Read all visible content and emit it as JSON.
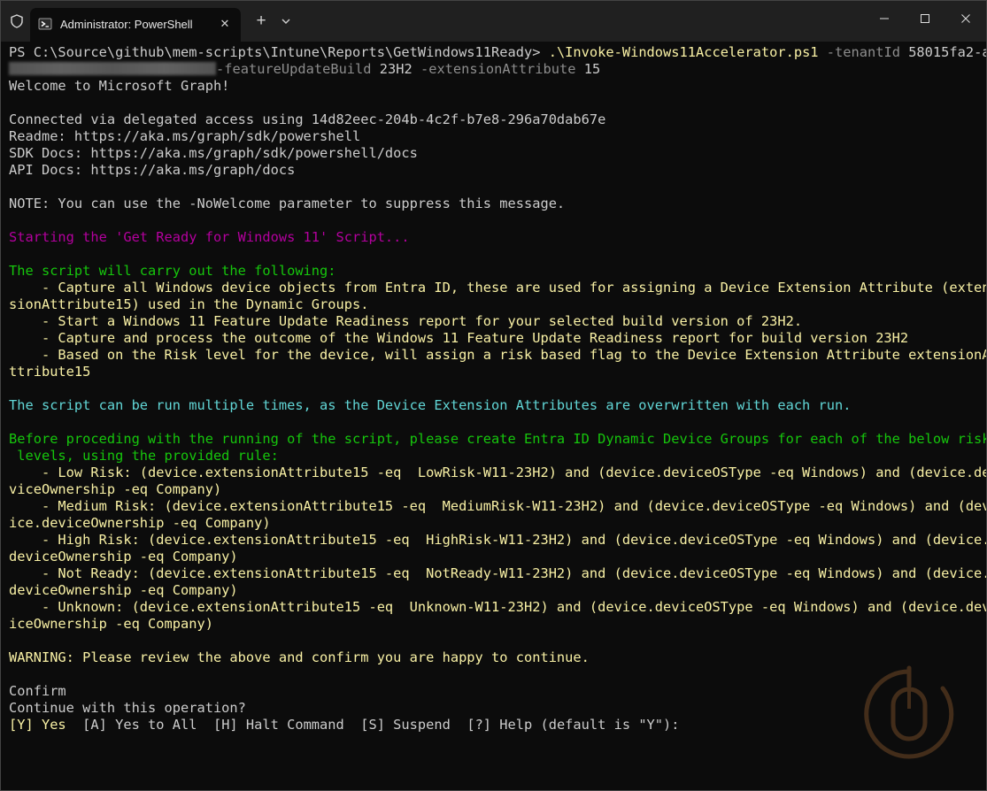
{
  "window": {
    "tab_title": "Administrator: PowerShell",
    "tab_close": "✕",
    "new_tab": "+"
  },
  "terminal": {
    "lines": [
      {
        "segments": [
          {
            "text": "PS C:\\Source\\github\\mem-scripts\\Intune\\Reports\\GetWindows11Ready> ",
            "color": "def"
          },
          {
            "text": ".\\Invoke-Windows11Accelerator.ps1",
            "color": "yel"
          },
          {
            "text": " -tenantId ",
            "color": "gry"
          },
          {
            "text": "58015fa2-a",
            "color": "def"
          }
        ]
      },
      {
        "segments": [
          {
            "text": "",
            "color": "def",
            "redacted": true
          },
          {
            "text": "-featureUpdateBuild ",
            "color": "gry"
          },
          {
            "text": "23H2 ",
            "color": "def"
          },
          {
            "text": "-extensionAttribute ",
            "color": "gry"
          },
          {
            "text": "15",
            "color": "def"
          }
        ]
      },
      {
        "segments": [
          {
            "text": "Welcome to Microsoft Graph!",
            "color": "def"
          }
        ]
      },
      {
        "segments": [
          {
            "text": "",
            "color": "def"
          }
        ]
      },
      {
        "segments": [
          {
            "text": "Connected via delegated access using 14d82eec-204b-4c2f-b7e8-296a70dab67e",
            "color": "def"
          }
        ]
      },
      {
        "segments": [
          {
            "text": "Readme: https://aka.ms/graph/sdk/powershell",
            "color": "def"
          }
        ]
      },
      {
        "segments": [
          {
            "text": "SDK Docs: https://aka.ms/graph/sdk/powershell/docs",
            "color": "def"
          }
        ]
      },
      {
        "segments": [
          {
            "text": "API Docs: https://aka.ms/graph/docs",
            "color": "def"
          }
        ]
      },
      {
        "segments": [
          {
            "text": "",
            "color": "def"
          }
        ]
      },
      {
        "segments": [
          {
            "text": "NOTE: You can use the -NoWelcome parameter to suppress this message.",
            "color": "def"
          }
        ]
      },
      {
        "segments": [
          {
            "text": "",
            "color": "def"
          }
        ]
      },
      {
        "segments": [
          {
            "text": "Starting the 'Get Ready for Windows 11' Script...",
            "color": "mag"
          }
        ]
      },
      {
        "segments": [
          {
            "text": "",
            "color": "def"
          }
        ]
      },
      {
        "segments": [
          {
            "text": "The script will carry out the following:",
            "color": "grn"
          }
        ]
      },
      {
        "segments": [
          {
            "text": "    - Capture all Windows device objects from Entra ID, these are used for assigning a Device Extension Attribute (exten",
            "color": "yel"
          }
        ]
      },
      {
        "segments": [
          {
            "text": "sionAttribute15) used in the Dynamic Groups.",
            "color": "yel"
          }
        ]
      },
      {
        "segments": [
          {
            "text": "    - Start a Windows 11 Feature Update Readiness report for your selected build version of 23H2.",
            "color": "yel"
          }
        ]
      },
      {
        "segments": [
          {
            "text": "    - Capture and process the outcome of the Windows 11 Feature Update Readiness report for build version 23H2",
            "color": "yel"
          }
        ]
      },
      {
        "segments": [
          {
            "text": "    - Based on the Risk level for the device, will assign a risk based flag to the Device Extension Attribute extensionA",
            "color": "yel"
          }
        ]
      },
      {
        "segments": [
          {
            "text": "ttribute15",
            "color": "yel"
          }
        ]
      },
      {
        "segments": [
          {
            "text": "",
            "color": "def"
          }
        ]
      },
      {
        "segments": [
          {
            "text": "The script can be run multiple times, as the Device Extension Attributes are overwritten with each run.",
            "color": "cyn"
          }
        ]
      },
      {
        "segments": [
          {
            "text": "",
            "color": "def"
          }
        ]
      },
      {
        "segments": [
          {
            "text": "Before proceding with the running of the script, please create Entra ID Dynamic Device Groups for each of the below risk",
            "color": "grn"
          }
        ]
      },
      {
        "segments": [
          {
            "text": " levels, using the provided rule:",
            "color": "grn"
          }
        ]
      },
      {
        "segments": [
          {
            "text": "    - Low Risk: (device.extensionAttribute15 -eq  LowRisk-W11-23H2) and (device.deviceOSType -eq Windows) and (device.de",
            "color": "yel"
          }
        ]
      },
      {
        "segments": [
          {
            "text": "viceOwnership -eq Company)",
            "color": "yel"
          }
        ]
      },
      {
        "segments": [
          {
            "text": "    - Medium Risk: (device.extensionAttribute15 -eq  MediumRisk-W11-23H2) and (device.deviceOSType -eq Windows) and (dev",
            "color": "yel"
          }
        ]
      },
      {
        "segments": [
          {
            "text": "ice.deviceOwnership -eq Company)",
            "color": "yel"
          }
        ]
      },
      {
        "segments": [
          {
            "text": "    - High Risk: (device.extensionAttribute15 -eq  HighRisk-W11-23H2) and (device.deviceOSType -eq Windows) and (device.",
            "color": "yel"
          }
        ]
      },
      {
        "segments": [
          {
            "text": "deviceOwnership -eq Company)",
            "color": "yel"
          }
        ]
      },
      {
        "segments": [
          {
            "text": "    - Not Ready: (device.extensionAttribute15 -eq  NotReady-W11-23H2) and (device.deviceOSType -eq Windows) and (device.",
            "color": "yel"
          }
        ]
      },
      {
        "segments": [
          {
            "text": "deviceOwnership -eq Company)",
            "color": "yel"
          }
        ]
      },
      {
        "segments": [
          {
            "text": "    - Unknown: (device.extensionAttribute15 -eq  Unknown-W11-23H2) and (device.deviceOSType -eq Windows) and (device.dev",
            "color": "yel"
          }
        ]
      },
      {
        "segments": [
          {
            "text": "iceOwnership -eq Company)",
            "color": "yel"
          }
        ]
      },
      {
        "segments": [
          {
            "text": "",
            "color": "def"
          }
        ]
      },
      {
        "segments": [
          {
            "text": "WARNING: Please review the above and confirm you are happy to continue.",
            "color": "yel"
          }
        ]
      },
      {
        "segments": [
          {
            "text": "",
            "color": "def"
          }
        ]
      },
      {
        "segments": [
          {
            "text": "Confirm",
            "color": "def"
          }
        ]
      },
      {
        "segments": [
          {
            "text": "Continue with this operation?",
            "color": "def"
          }
        ]
      },
      {
        "segments": [
          {
            "text": "[Y] Yes",
            "color": "yel"
          },
          {
            "text": "  [A] Yes to All  [H] Halt Command  [S] Suspend  ",
            "color": "def"
          },
          {
            "text": "[?] Help (default is \"Y\"):",
            "color": "def"
          }
        ]
      }
    ]
  },
  "colors": {
    "background": "#0c0c0c",
    "default_text": "#cccccc",
    "yellow": "#f9f1a5",
    "magenta": "#b4009e",
    "green": "#16c60c",
    "cyan": "#61d6d6",
    "gray": "#8d8d8d"
  },
  "icons": [
    "shield-icon",
    "powershell-icon",
    "close-icon",
    "plus-icon",
    "chevron-down-icon",
    "minimize-icon",
    "maximize-icon",
    "close-window-icon",
    "mouse-watermark-icon"
  ]
}
